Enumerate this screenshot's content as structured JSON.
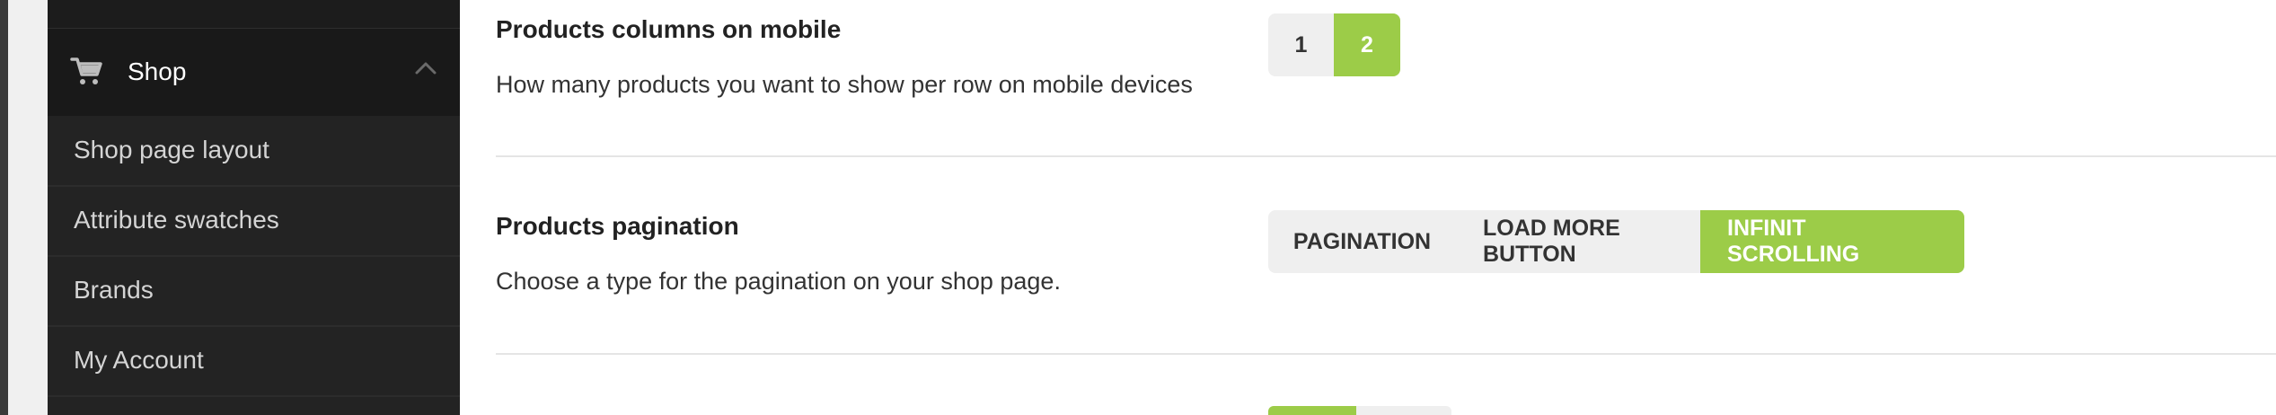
{
  "sidebar": {
    "section": {
      "label": "Shop",
      "icon": "cart-icon",
      "toggle_icon": "chevron-up-icon"
    },
    "items": [
      {
        "label": "Shop page layout"
      },
      {
        "label": "Attribute swatches"
      },
      {
        "label": "Brands"
      },
      {
        "label": "My Account"
      }
    ]
  },
  "settings": {
    "mobile_columns": {
      "title": "Products columns on mobile",
      "description": "How many products you want to show per row on mobile devices",
      "options": [
        "1",
        "2"
      ],
      "selected": "2"
    },
    "pagination": {
      "title": "Products pagination",
      "description": "Choose a type for the pagination on your shop page.",
      "options": [
        "PAGINATION",
        "LOAD MORE BUTTON",
        "INFINIT SCROLLING"
      ],
      "selected": "INFINIT SCROLLING"
    }
  },
  "colors": {
    "accent": "#9ccc48",
    "sidebar_bg": "#232323",
    "sidebar_section_bg": "#191919"
  }
}
